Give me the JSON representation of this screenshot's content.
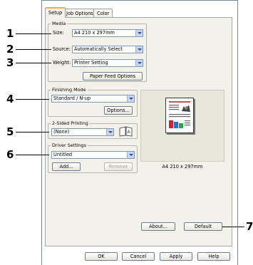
{
  "tabs": [
    "Setup",
    "Job Options",
    "Color"
  ],
  "media": {
    "group_label": "Media",
    "size_label": "Size:",
    "size_value": "A4 210 x 297mm",
    "source_label": "Source:",
    "source_value": "Automatically Select",
    "weight_label": "Weight:",
    "weight_value": "Printer Setting",
    "paper_feed_button": "Paper Feed Options"
  },
  "finishing": {
    "group_label": "Finishing Mode",
    "value": "Standard / N-up",
    "options_button": "Options..."
  },
  "two_sided": {
    "group_label": "2-Sided Printing",
    "value": "(None)"
  },
  "driver": {
    "group_label": "Driver Settings",
    "value": "Untitled",
    "add_button": "Add...",
    "remove_button": "Remove"
  },
  "preview_caption": "A4 210 x 297mm",
  "about_button": "About...",
  "default_button": "Default",
  "bottom_buttons": [
    "OK",
    "Cancel",
    "Apply",
    "Help"
  ],
  "callouts": [
    "1",
    "2",
    "3",
    "4",
    "5",
    "6",
    "7"
  ],
  "colors": {
    "tab_highlight": "#f0b03c",
    "panel_bg": "#f2f1ea",
    "preview_bg": "#e8e7dc"
  }
}
